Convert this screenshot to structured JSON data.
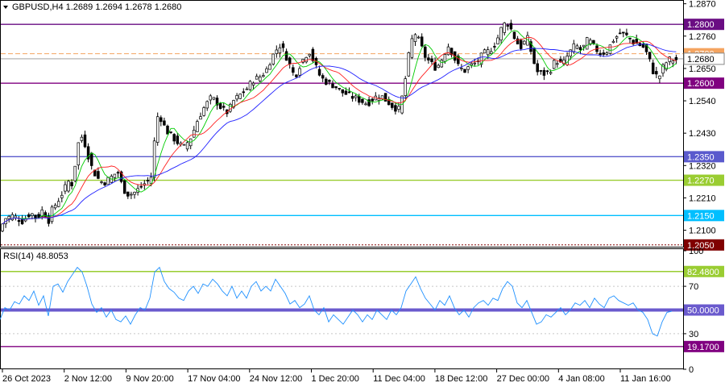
{
  "header": {
    "title": "GBPUSD,H4  1.2689 1.2694 1.2678 1.2680",
    "menu_icon": "triangle-down-icon"
  },
  "chart_data": [
    {
      "type": "candlestick",
      "symbol": "GBPUSD",
      "timeframe": "H4",
      "ohlc_readout": {
        "open": 1.2689,
        "high": 1.2694,
        "low": 1.2678,
        "close": 1.268
      },
      "ylim": [
        1.2044,
        1.288
      ],
      "y_ticks": [
        1.287,
        1.276,
        1.265,
        1.254,
        1.243,
        1.232,
        1.221,
        1.21
      ],
      "x_tick_labels": [
        "26 Oct 2023",
        "2 Nov 12:00",
        "9 Nov 20:00",
        "17 Nov 04:00",
        "24 Nov 12:00",
        "1 Dec 20:00",
        "11 Dec 04:00",
        "18 Dec 12:00",
        "27 Dec 00:00",
        "4 Jan 08:00",
        "11 Jan 16:00"
      ],
      "price_path": [
        [
          0,
          1.209
        ],
        [
          8,
          1.214
        ],
        [
          18,
          1.215
        ],
        [
          30,
          1.213
        ],
        [
          40,
          1.216
        ],
        [
          48,
          1.214
        ],
        [
          55,
          1.217
        ],
        [
          62,
          1.213
        ],
        [
          68,
          1.218
        ],
        [
          72,
          1.219
        ],
        [
          80,
          1.223
        ],
        [
          88,
          1.227
        ],
        [
          93,
          1.225
        ],
        [
          97,
          1.238
        ],
        [
          103,
          1.242
        ],
        [
          108,
          1.239
        ],
        [
          115,
          1.232
        ],
        [
          122,
          1.228
        ],
        [
          130,
          1.226
        ],
        [
          140,
          1.228
        ],
        [
          148,
          1.23
        ],
        [
          155,
          1.224
        ],
        [
          162,
          1.222
        ],
        [
          170,
          1.223
        ],
        [
          178,
          1.225
        ],
        [
          186,
          1.227
        ],
        [
          192,
          1.229
        ],
        [
          195,
          1.249
        ],
        [
          202,
          1.248
        ],
        [
          208,
          1.244
        ],
        [
          215,
          1.242
        ],
        [
          222,
          1.24
        ],
        [
          230,
          1.238
        ],
        [
          240,
          1.242
        ],
        [
          248,
          1.248
        ],
        [
          256,
          1.252
        ],
        [
          264,
          1.255
        ],
        [
          270,
          1.254
        ],
        [
          278,
          1.251
        ],
        [
          285,
          1.25
        ],
        [
          292,
          1.254
        ],
        [
          300,
          1.256
        ],
        [
          308,
          1.258
        ],
        [
          316,
          1.261
        ],
        [
          324,
          1.262
        ],
        [
          332,
          1.264
        ],
        [
          338,
          1.268
        ],
        [
          344,
          1.271
        ],
        [
          350,
          1.273
        ],
        [
          356,
          1.27
        ],
        [
          362,
          1.266
        ],
        [
          368,
          1.262
        ],
        [
          374,
          1.266
        ],
        [
          380,
          1.269
        ],
        [
          386,
          1.271
        ],
        [
          392,
          1.267
        ],
        [
          398,
          1.263
        ],
        [
          404,
          1.261
        ],
        [
          410,
          1.26
        ],
        [
          418,
          1.259
        ],
        [
          426,
          1.257
        ],
        [
          434,
          1.256
        ],
        [
          442,
          1.255
        ],
        [
          450,
          1.254
        ],
        [
          458,
          1.253
        ],
        [
          466,
          1.255
        ],
        [
          474,
          1.256
        ],
        [
          482,
          1.254
        ],
        [
          490,
          1.252
        ],
        [
          497,
          1.251
        ],
        [
          503,
          1.257
        ],
        [
          507,
          1.265
        ],
        [
          512,
          1.274
        ],
        [
          518,
          1.277
        ],
        [
          524,
          1.273
        ],
        [
          530,
          1.269
        ],
        [
          536,
          1.267
        ],
        [
          544,
          1.265
        ],
        [
          552,
          1.269
        ],
        [
          558,
          1.273
        ],
        [
          564,
          1.27
        ],
        [
          570,
          1.266
        ],
        [
          578,
          1.264
        ],
        [
          586,
          1.266
        ],
        [
          594,
          1.267
        ],
        [
          602,
          1.27
        ],
        [
          610,
          1.271
        ],
        [
          618,
          1.274
        ],
        [
          625,
          1.279
        ],
        [
          631,
          1.281
        ],
        [
          637,
          1.278
        ],
        [
          643,
          1.274
        ],
        [
          650,
          1.272
        ],
        [
          656,
          1.276
        ],
        [
          662,
          1.27
        ],
        [
          668,
          1.264
        ],
        [
          676,
          1.263
        ],
        [
          684,
          1.264
        ],
        [
          692,
          1.268
        ],
        [
          700,
          1.266
        ],
        [
          708,
          1.27
        ],
        [
          716,
          1.273
        ],
        [
          724,
          1.271
        ],
        [
          732,
          1.275
        ],
        [
          740,
          1.272
        ],
        [
          748,
          1.27
        ],
        [
          756,
          1.271
        ],
        [
          764,
          1.275
        ],
        [
          772,
          1.277
        ],
        [
          780,
          1.276
        ],
        [
          788,
          1.274
        ],
        [
          796,
          1.273
        ],
        [
          802,
          1.272
        ],
        [
          808,
          1.268
        ],
        [
          814,
          1.263
        ],
        [
          820,
          1.262
        ],
        [
          826,
          1.266
        ],
        [
          832,
          1.268
        ],
        [
          838,
          1.268
        ]
      ],
      "moving_averages": [
        {
          "color": "#00cc00",
          "lag": 5
        },
        {
          "color": "#ff2020",
          "lag": 11
        },
        {
          "color": "#2020ff",
          "lag": 22
        }
      ],
      "horizontal_levels": [
        {
          "price": 1.28,
          "label": "1.2800",
          "color": "#6a0d83",
          "style": "solid"
        },
        {
          "price": 1.27,
          "label": "1.2700",
          "color": "#f4a460",
          "style": "dashed"
        },
        {
          "price": 1.2683,
          "label": "1.2680",
          "color": "#c0c0c0",
          "style": "solid"
        },
        {
          "price": 1.26,
          "label": "1.2600",
          "color": "#800080",
          "style": "solid"
        },
        {
          "price": 1.235,
          "label": "1.2350",
          "color": "#5a5acd",
          "style": "solid"
        },
        {
          "price": 1.227,
          "label": "1.2270",
          "color": "#9acd32",
          "style": "solid"
        },
        {
          "price": 1.215,
          "label": "1.2150",
          "color": "#00bfff",
          "style": "solid"
        },
        {
          "price": 1.205,
          "label": "1.2050",
          "color": "#800000",
          "style": "dotted"
        }
      ]
    },
    {
      "type": "line",
      "title": "RSI(14) 48.8053",
      "ylim": [
        0,
        100
      ],
      "y_ticks": [
        100,
        70,
        30,
        0
      ],
      "levels": [
        {
          "value": 82.48,
          "label": "82.4800",
          "color": "#9acd32"
        },
        {
          "value": 50.0,
          "label": "50.0000",
          "color": "#6a5acd"
        },
        {
          "value": 19.17,
          "label": "19.1700",
          "color": "#800080"
        }
      ],
      "line_color": "#1e90ff",
      "points": [
        [
          0,
          42
        ],
        [
          6,
          52
        ],
        [
          12,
          50
        ],
        [
          18,
          57
        ],
        [
          24,
          55
        ],
        [
          30,
          62
        ],
        [
          36,
          58
        ],
        [
          42,
          66
        ],
        [
          48,
          54
        ],
        [
          54,
          62
        ],
        [
          60,
          45
        ],
        [
          66,
          70
        ],
        [
          72,
          72
        ],
        [
          78,
          65
        ],
        [
          84,
          74
        ],
        [
          90,
          80
        ],
        [
          96,
          86
        ],
        [
          102,
          82
        ],
        [
          108,
          70
        ],
        [
          114,
          55
        ],
        [
          120,
          48
        ],
        [
          126,
          52
        ],
        [
          132,
          44
        ],
        [
          138,
          50
        ],
        [
          144,
          42
        ],
        [
          150,
          40
        ],
        [
          156,
          45
        ],
        [
          162,
          38
        ],
        [
          168,
          46
        ],
        [
          174,
          52
        ],
        [
          180,
          50
        ],
        [
          186,
          60
        ],
        [
          192,
          82
        ],
        [
          198,
          86
        ],
        [
          204,
          74
        ],
        [
          210,
          68
        ],
        [
          216,
          65
        ],
        [
          222,
          60
        ],
        [
          228,
          58
        ],
        [
          234,
          66
        ],
        [
          240,
          70
        ],
        [
          246,
          64
        ],
        [
          252,
          72
        ],
        [
          258,
          70
        ],
        [
          264,
          76
        ],
        [
          270,
          72
        ],
        [
          276,
          66
        ],
        [
          282,
          62
        ],
        [
          288,
          70
        ],
        [
          294,
          60
        ],
        [
          300,
          66
        ],
        [
          306,
          60
        ],
        [
          312,
          70
        ],
        [
          318,
          74
        ],
        [
          324,
          66
        ],
        [
          330,
          70
        ],
        [
          336,
          66
        ],
        [
          342,
          76
        ],
        [
          348,
          70
        ],
        [
          354,
          64
        ],
        [
          360,
          55
        ],
        [
          366,
          58
        ],
        [
          372,
          52
        ],
        [
          378,
          55
        ],
        [
          384,
          62
        ],
        [
          390,
          50
        ],
        [
          396,
          46
        ],
        [
          402,
          52
        ],
        [
          408,
          40
        ],
        [
          414,
          46
        ],
        [
          420,
          42
        ],
        [
          426,
          38
        ],
        [
          432,
          44
        ],
        [
          438,
          50
        ],
        [
          444,
          46
        ],
        [
          450,
          40
        ],
        [
          456,
          46
        ],
        [
          462,
          42
        ],
        [
          468,
          50
        ],
        [
          474,
          46
        ],
        [
          480,
          42
        ],
        [
          486,
          50
        ],
        [
          492,
          46
        ],
        [
          498,
          52
        ],
        [
          504,
          66
        ],
        [
          510,
          72
        ],
        [
          516,
          78
        ],
        [
          522,
          68
        ],
        [
          528,
          60
        ],
        [
          534,
          55
        ],
        [
          540,
          50
        ],
        [
          546,
          58
        ],
        [
          552,
          54
        ],
        [
          558,
          62
        ],
        [
          564,
          52
        ],
        [
          570,
          46
        ],
        [
          576,
          50
        ],
        [
          582,
          44
        ],
        [
          588,
          52
        ],
        [
          594,
          56
        ],
        [
          600,
          58
        ],
        [
          606,
          54
        ],
        [
          612,
          60
        ],
        [
          618,
          58
        ],
        [
          624,
          68
        ],
        [
          630,
          74
        ],
        [
          636,
          70
        ],
        [
          642,
          56
        ],
        [
          648,
          52
        ],
        [
          654,
          58
        ],
        [
          660,
          48
        ],
        [
          666,
          38
        ],
        [
          672,
          40
        ],
        [
          678,
          46
        ],
        [
          684,
          44
        ],
        [
          690,
          48
        ],
        [
          696,
          52
        ],
        [
          702,
          46
        ],
        [
          708,
          50
        ],
        [
          714,
          56
        ],
        [
          720,
          54
        ],
        [
          726,
          58
        ],
        [
          732,
          52
        ],
        [
          738,
          60
        ],
        [
          744,
          55
        ],
        [
          750,
          52
        ],
        [
          756,
          60
        ],
        [
          762,
          62
        ],
        [
          768,
          58
        ],
        [
          774,
          56
        ],
        [
          780,
          54
        ],
        [
          786,
          56
        ],
        [
          792,
          50
        ],
        [
          798,
          48
        ],
        [
          804,
          42
        ],
        [
          810,
          30
        ],
        [
          816,
          28
        ],
        [
          822,
          40
        ],
        [
          828,
          48
        ],
        [
          834,
          49
        ]
      ],
      "x_tick_labels": [
        "26 Oct 2023",
        "2 Nov 12:00",
        "9 Nov 20:00",
        "17 Nov 04:00",
        "24 Nov 12:00",
        "1 Dec 20:00",
        "11 Dec 04:00",
        "18 Dec 12:00",
        "27 Dec 00:00",
        "4 Jan 08:00",
        "11 Jan 16:00"
      ]
    }
  ]
}
